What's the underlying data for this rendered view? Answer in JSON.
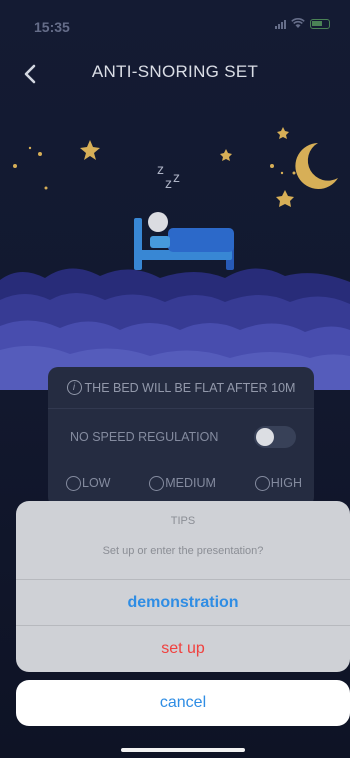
{
  "status_bar": {
    "time": "15:35"
  },
  "header": {
    "title": "ANTI-SNORING SET"
  },
  "scene": {
    "sleep_text": "zzz"
  },
  "settings": {
    "info_icon_glyph": "i",
    "info_text": "THE BED WILL BE FLAT AFTER 10M",
    "speed_label": "NO SPEED REGULATION",
    "speed_enabled": false,
    "levels": [
      "LOW",
      "MEDIUM",
      "HIGH"
    ]
  },
  "action_sheet": {
    "title": "TIPS",
    "message": "Set up or enter the presentation?",
    "demo_label": "demonstration",
    "setup_label": "set up",
    "cancel_label": "cancel"
  },
  "colors": {
    "accent_blue": "#2f8de4",
    "destructive_red": "#f0413f",
    "star_gold": "#e3b95c",
    "bed_blue": "#3b8fe0"
  }
}
